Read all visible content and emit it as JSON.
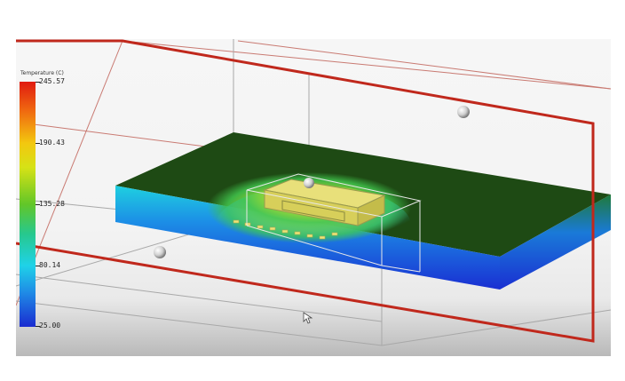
{
  "legend": {
    "title": "Temperature (C)",
    "max": "245.57",
    "v2": "190.43",
    "v3": "135.28",
    "v4": "80.14",
    "min": "25.00",
    "colors": [
      "#e01a10",
      "#f06a10",
      "#f3c70f",
      "#d6e216",
      "#62c628",
      "#27c88d",
      "#1fd2e8",
      "#1f8be6",
      "#1a2bd0"
    ]
  },
  "scene": {
    "bounding_box_color": "#c0281c",
    "board_top_color": "#1e4a14",
    "hotspot_color": "#f1e23a",
    "probe_color": "#dcdcdc"
  }
}
